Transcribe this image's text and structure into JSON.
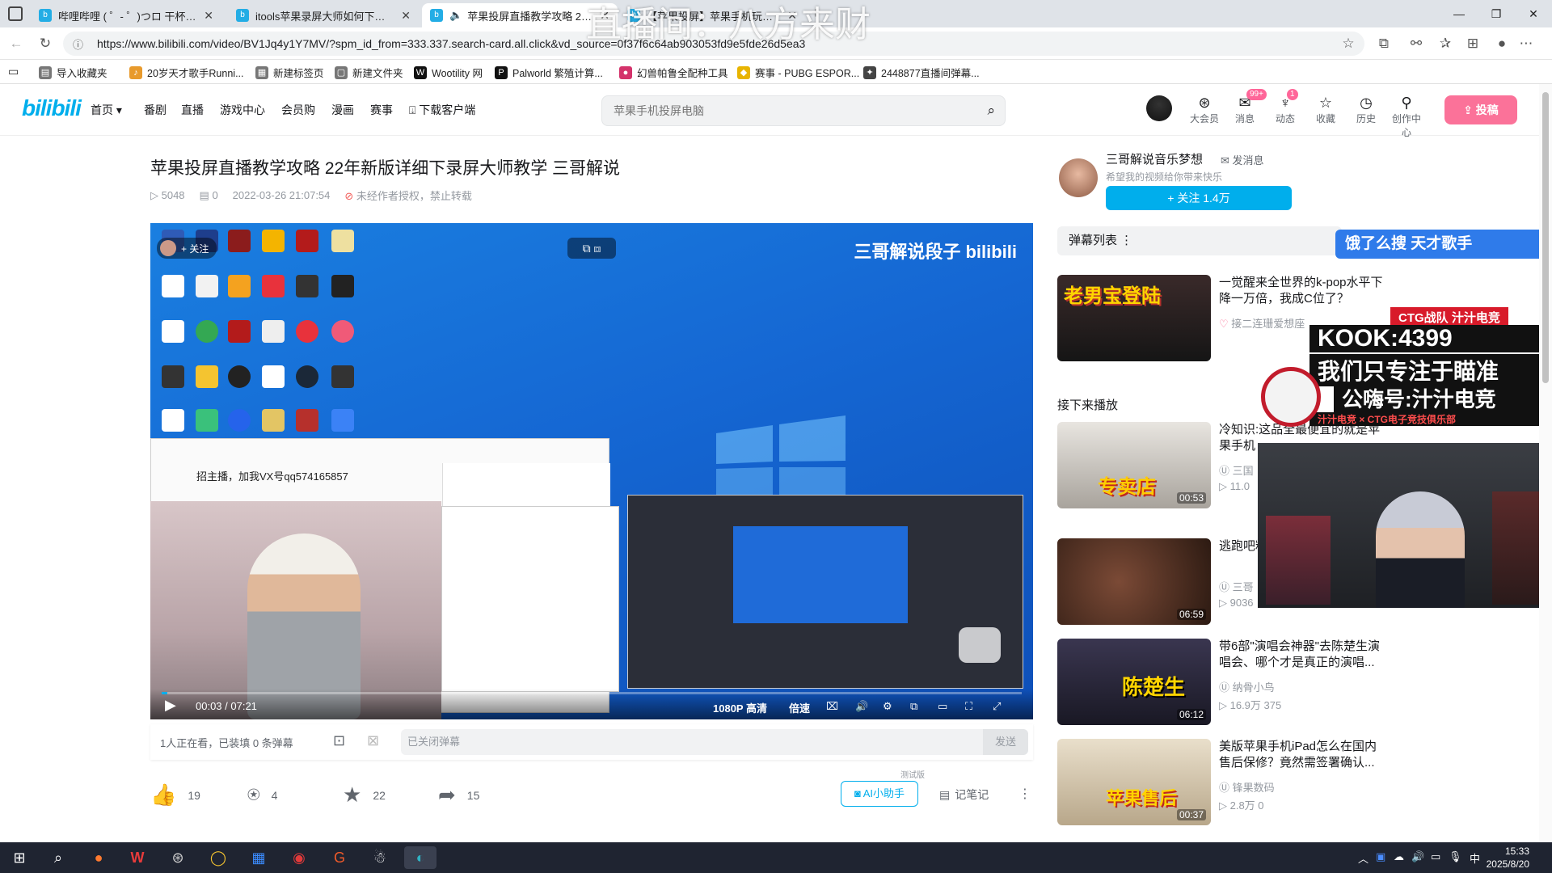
{
  "tabs": [
    {
      "label": "哔哩哔哩 ( ゜- ゜)つロ 干杯~-bilibili",
      "active": false
    },
    {
      "label": "itools苹果录屏大师如何下载-哔哩哔哩",
      "active": false
    },
    {
      "label": "苹果投屏直播教学攻略 22年新版",
      "active": true
    },
    {
      "label": "【苹果投屏】苹果手机玩游戏如何",
      "active": false
    }
  ],
  "address": {
    "url": "https://www.bilibili.com/video/BV1Jq4y1Y7MV/?spm_id_from=333.337.search-card.all.click&vd_source=0f37f6c64ab903053fd9e5fde26d5ea3"
  },
  "bookmarks": [
    {
      "label": "导入收藏夹",
      "color": "#555"
    },
    {
      "label": "20岁天才歌手Runni...",
      "color": "#e89a2c"
    },
    {
      "label": "新建标签页",
      "color": "#555"
    },
    {
      "label": "新建文件夹",
      "color": "#555"
    },
    {
      "label": "Wootility 网",
      "color": "#111"
    },
    {
      "label": "Palworld 繁殖计算...",
      "color": "#111"
    },
    {
      "label": "幻兽帕鲁全配种工具",
      "color": "#d4336b"
    },
    {
      "label": "赛事 - PUBG ESPOR...",
      "color": "#e8b400"
    },
    {
      "label": "2448877直播间弹幕...",
      "color": "#444"
    }
  ],
  "header": {
    "logo": "bilibili",
    "nav": [
      "首页 ▾",
      "番剧",
      "直播",
      "游戏中心",
      "会员购",
      "漫画",
      "赛事",
      "下载客户端"
    ],
    "search_placeholder": "苹果手机投屏电脑",
    "icons": [
      {
        "label": "大会员",
        "glyph": "⊛"
      },
      {
        "label": "消息",
        "glyph": "✉",
        "badge": "99+"
      },
      {
        "label": "动态",
        "glyph": "♆",
        "badge": "1"
      },
      {
        "label": "收藏",
        "glyph": "☆"
      },
      {
        "label": "历史",
        "glyph": "◷"
      },
      {
        "label": "创作中心",
        "glyph": "⚲"
      }
    ],
    "upload": "⇪ 投稿"
  },
  "video": {
    "title": "苹果投屏直播教学攻略 22年新版详细下录屏大师教学 三哥解说",
    "views": "5048",
    "danmaku_count": "0",
    "date": "2022-03-26 21:07:54",
    "copyright": "未经作者授权，禁止转载"
  },
  "player": {
    "follow_tag": "+ 关注",
    "watermark": "三哥解说段子 bilibili",
    "time": "00:03 / 07:21",
    "progress": 0.007,
    "quality": "1080P 高清",
    "speed": "倍速",
    "panel_title": "招主播，加我VX号qq574165857"
  },
  "danmaku_bar": {
    "watching": "1人正在看，已装填 0 条弹幕",
    "input_placeholder": "已关闭弹幕",
    "send": "发送"
  },
  "actions": {
    "like": "19",
    "coin": "4",
    "fav": "22",
    "share": "15",
    "ai": "AI小助手",
    "ai_beta": "测试版",
    "notes": "记笔记"
  },
  "uploader": {
    "name": "三哥解说音乐梦想",
    "message": "✉ 发消息",
    "desc": "希望我的视频给你带来快乐",
    "follow": "+ 关注 1.4万"
  },
  "danmaku_list": "弹幕列表  ⋮",
  "next_label": "接下来播放",
  "recommendations": [
    {
      "title": "一觉醒来全世界的k-pop水平下降一万倍，我成C位了？",
      "author": "接二连珊爱想座",
      "stats": "",
      "duration": "",
      "thumb_text": "老男宝登陆",
      "color": "#b5322a"
    },
    {
      "title": "冷知识:这品全最便宜的就是苹果手机",
      "author": "三国",
      "stats": "11.0",
      "duration": "00:53",
      "thumb_text": "专卖店",
      "color": "#cfcfcf"
    },
    {
      "title": "逃跑吧粉丝影",
      "author": "三哥",
      "stats": "9036",
      "duration": "06:59",
      "thumb_text": "",
      "color": "#6a3b2a"
    },
    {
      "title": "带6部\"演唱会神器\"去陈楚生演唱会、哪个才是真正的演唱...",
      "author": "纳骨小鸟",
      "stats": "16.9万  375",
      "duration": "06:12",
      "thumb_text": "陈楚生",
      "color": "#2b2b3a"
    },
    {
      "title": "美版苹果手机iPad怎么在国内售后保修？竟然需签署确认...",
      "author": "锋果数码",
      "stats": "2.8万  0",
      "duration": "00:37",
      "thumb_text": "苹果售后",
      "color": "#c9b89a"
    }
  ],
  "overlays": {
    "search_banner": "饿了么搜 天才歌手",
    "kook_line1": "KOOK:4399",
    "kook_line2": "我们只专注于瞄准",
    "kook_line3": "公嗨号:汁汁电竞",
    "kook_tag": "CTG战队 汁汁电竞",
    "kook_footer": "汁汁电竞 × CTG电子竞技俱乐部",
    "watermark": "直播间：八方来财"
  },
  "taskbar": {
    "time": "15:33",
    "date": "2025/8/20",
    "ime": "中"
  }
}
